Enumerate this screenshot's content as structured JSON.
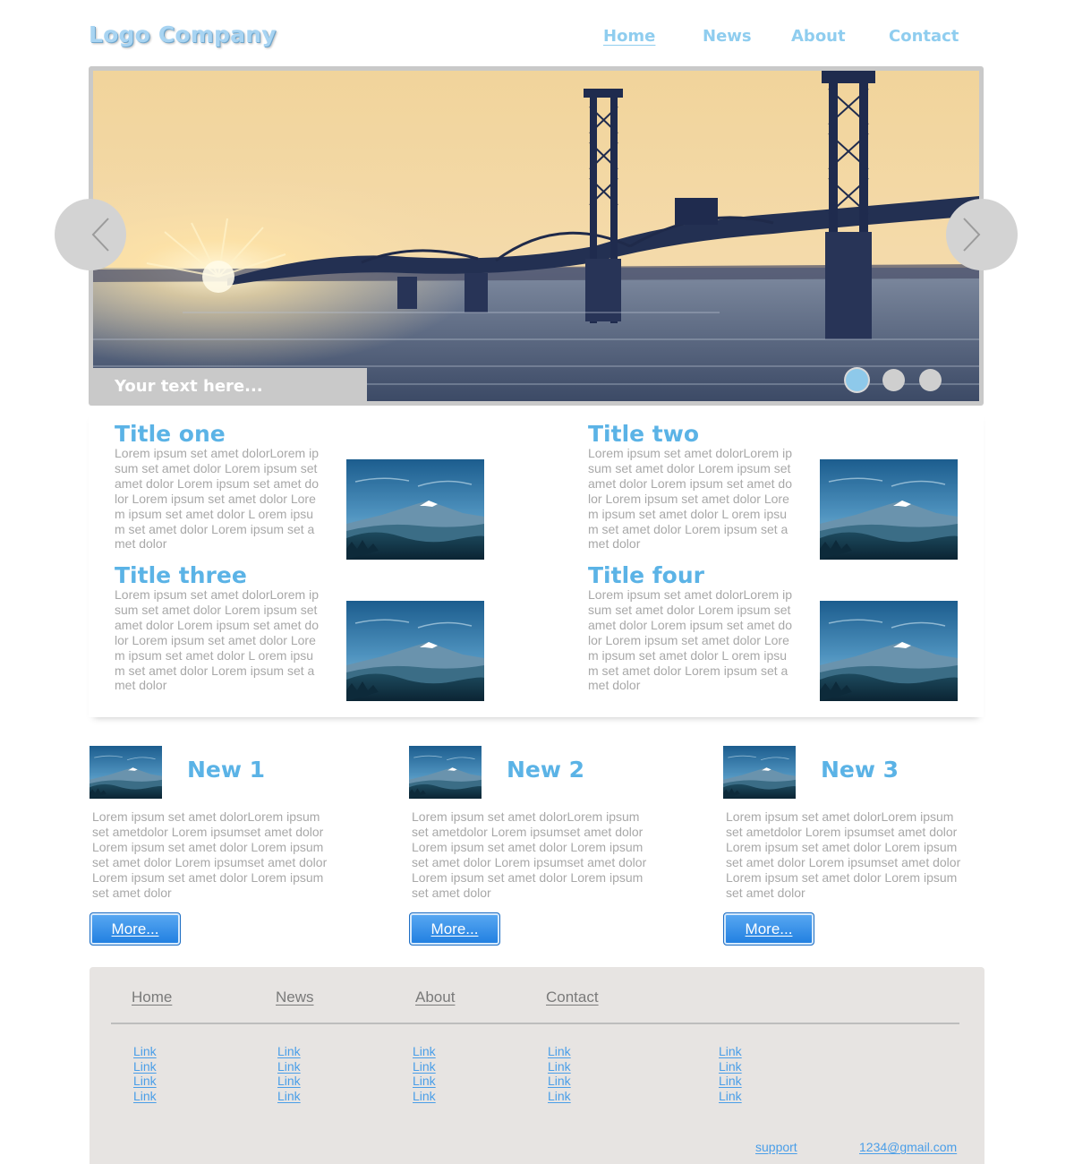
{
  "header": {
    "logo": "Logo Company",
    "nav": [
      {
        "label": "Home",
        "active": true
      },
      {
        "label": "News",
        "active": false
      },
      {
        "label": "About",
        "active": false
      },
      {
        "label": "Contact",
        "active": false
      }
    ]
  },
  "slider": {
    "caption": "Your text here...",
    "slide_count": 3,
    "active_slide": 1
  },
  "features": [
    {
      "title": "Title one",
      "text": "Lorem ipsum set amet dolorLorem ipsum set amet dolor Lorem ipsum set amet dolor Lorem ipsum set amet dolor Lorem ipsum set amet dolor Lorem ipsum set amet dolor L orem ipsum set amet dolor Lorem ipsum set amet dolor"
    },
    {
      "title": "Title two",
      "text": "Lorem ipsum set amet dolorLorem ipsum set amet dolor Lorem ipsum set amet dolor Lorem ipsum set amet dolor Lorem ipsum set amet dolor Lorem ipsum set amet dolor L orem ipsum set amet dolor Lorem ipsum set amet dolor"
    },
    {
      "title": "Title three",
      "text": "Lorem ipsum set amet dolorLorem ipsum set amet dolor Lorem ipsum set amet dolor Lorem ipsum set amet dolor Lorem ipsum set amet dolor Lorem ipsum set amet dolor L orem ipsum set amet dolor Lorem ipsum set amet dolor"
    },
    {
      "title": "Title four",
      "text": "Lorem ipsum set amet dolorLorem ipsum set amet dolor Lorem ipsum set amet dolor Lorem ipsum set amet dolor Lorem ipsum set amet dolor Lorem ipsum set amet dolor L orem ipsum set amet dolor Lorem ipsum set amet dolor"
    }
  ],
  "news": [
    {
      "title": "New 1",
      "text": "Lorem ipsum set amet dolorLorem ipsum set ametdolor Lorem ipsumset amet dolor Lorem ipsum set amet dolor Lorem ipsum set amet dolor Lorem ipsumset amet dolor Lorem ipsum set amet dolor Lorem ipsum set amet dolor",
      "button": "More..."
    },
    {
      "title": "New 2",
      "text": "Lorem ipsum set amet dolorLorem ipsum set ametdolor Lorem ipsumset amet dolor Lorem ipsum set amet dolor Lorem ipsum set amet dolor Lorem ipsumset amet dolor Lorem ipsum set amet dolor Lorem ipsum set amet dolor",
      "button": "More..."
    },
    {
      "title": "New 3",
      "text": "Lorem ipsum set amet dolorLorem ipsum set ametdolor Lorem ipsumset amet dolor Lorem ipsum set amet dolor Lorem ipsum set amet dolor Lorem ipsumset amet dolor Lorem ipsum set amet dolor Lorem ipsum set amet dolor",
      "button": "More..."
    }
  ],
  "footer": {
    "nav": [
      "Home",
      "News",
      "About",
      "Contact"
    ],
    "link_columns": [
      [
        "Link",
        "Link",
        "Link",
        "Link"
      ],
      [
        "Link",
        "Link",
        "Link",
        "Link"
      ],
      [
        "Link",
        "Link",
        "Link",
        "Link"
      ],
      [
        "Link",
        "Link",
        "Link",
        "Link"
      ],
      [
        "Link",
        "Link",
        "Link",
        "Link"
      ]
    ],
    "support": "support",
    "email": "1234@gmail.com"
  },
  "colors": {
    "accent": "#5bb3e6",
    "nav": "#8fcdef",
    "body_text": "#a8a8a8",
    "link": "#4a9ee8",
    "footer_bg": "#e7e4e2",
    "button": "#1f7ee0"
  },
  "icons": {
    "slider_prev": "chevron-left-icon",
    "slider_next": "chevron-right-icon"
  }
}
